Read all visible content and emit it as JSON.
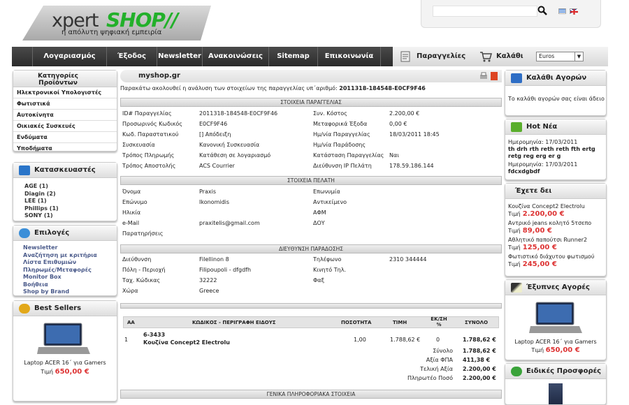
{
  "header": {
    "logo_xpert": "xpert",
    "logo_shop": "SHOP//",
    "tagline": "η απόλυτη ψηφιακή εμπειρία",
    "search_placeholder": ""
  },
  "nav": {
    "items": [
      "Λογαριασμός",
      "Έξοδος",
      "Newsletter",
      "Ανακοινώσεις",
      "Sitemap",
      "Επικοινωνία"
    ],
    "orders": "Παραγγελίες",
    "cart": "Καλάθι",
    "currency": "Euros"
  },
  "left": {
    "categories_title": "Κατηγορίες Προϊόντων",
    "categories": [
      "Ηλεκτρονικοί Υπολογιστές",
      "Φωτιστικά",
      "Αυτοκίνητα",
      "Οικιακές Συσκευές",
      "Ενδύματα",
      "Υποδήματα"
    ],
    "manufacturers_title": "Κατασκευαστές",
    "manufacturers": [
      "AGE (1)",
      "Diagin (2)",
      "LEE (1)",
      "Phillips (1)",
      "SONY (1)"
    ],
    "options_title": "Επιλογές",
    "options": [
      "Newsletter",
      "Αναζήτηση με κριτήρια",
      "Λίστα Επιθυμιών",
      "Πληρωμές/Μεταφορές",
      "Monitor Box",
      "Βοήθεια",
      "Shop by Brand"
    ],
    "bestsellers_title": "Best Sellers",
    "bestseller_name": "Laptop ACER 16΄ για Gamers",
    "bestseller_price_label": "Τιμή",
    "bestseller_price": "650,00 €"
  },
  "right": {
    "cart_title": "Καλάθι Αγορών",
    "cart_empty": "Το καλάθι αγορών σας είναι άδειο",
    "news_title": "Hot Νέα",
    "news": [
      {
        "date": "Ημερομηνία: 17/03/2011",
        "text": "th drh rth reth reth fth ertg retg reg erg er g"
      },
      {
        "date": "Ημερομηνία: 17/03/2011",
        "text": "fdcxdgbdf"
      }
    ],
    "seen_title": "Έχετε δει",
    "seen": [
      {
        "name": "Κουζίνα Concept2 Electrolu",
        "price": "2.200,00 €"
      },
      {
        "name": "Αντρικό jeans κολητό 5τσεπο",
        "price": "89,00 €"
      },
      {
        "name": "Αθλητικό παπούτσι Runner2",
        "price": "125,00 €"
      },
      {
        "name": "Φωτιστικό διάχυτου φωτισμού",
        "price": "245,00 €"
      }
    ],
    "price_label": "Τιμή",
    "smart_title": "Έξυπνες Αγορές",
    "smart_name": "Laptop ACER 16΄ για Gamers",
    "smart_price": "650,00 €",
    "offers_title": "Ειδικές Προσφορές"
  },
  "main": {
    "title": "myshop.gr",
    "intro": "Παρακάτω ακολουθεί η ανάλυση των στοιχείων της παραγγελίας υπ΄αριθμό:",
    "order_no": "2011318-184548-E0CF9F46",
    "order_section": "ΣΤΟΙΧΕΙΑ ΠΑΡΑΓΓΕΛΙΑΣ",
    "order_left": [
      [
        "ID# Παραγγελίας",
        "2011318-184548-E0CF9F46"
      ],
      [
        "Προσωρινός Κωδικός",
        "E0CF9F46"
      ],
      [
        "Κωδ. Παραστατικού",
        "[] Απόδειξη"
      ],
      [
        "Συσκευασία",
        "Κανονική Συσκευασία"
      ],
      [
        "Τρόπος Πληρωμής",
        "Κατάθεση σε λογαριασμό"
      ],
      [
        "Τρόπος Αποστολής",
        "ACS Courrier"
      ]
    ],
    "order_right": [
      [
        "Συν. Κόστος",
        "2.200,00 €"
      ],
      [
        "Μεταφορικά Έξοδα",
        "0,00 €"
      ],
      [
        "Ημ/νία Παραγγελίας",
        "18/03/2011 18:45"
      ],
      [
        "Ημ/νία Παράδοσης",
        ""
      ],
      [
        "Κατάσταση Παραγγελίας",
        "Ναι"
      ],
      [
        "Διεύθυνση IP Πελάτη",
        "178.59.186.144"
      ]
    ],
    "customer_section": "ΣΤΟΙΧΕΙΑ ΠΕΛΑΤΗ",
    "customer_left": [
      [
        "Όνομα",
        "Praxis"
      ],
      [
        "Επώνυμο",
        "Ikonomidis"
      ],
      [
        "Ηλικία",
        ""
      ],
      [
        "e-Mail",
        "praxitelis@gmail.com"
      ],
      [
        "Παρατηρήσεις",
        ""
      ]
    ],
    "customer_right": [
      [
        "Επωνυμία",
        ""
      ],
      [
        "Αντικείμενο",
        ""
      ],
      [
        "ΑΦΜ",
        ""
      ],
      [
        "ΔΟΥ",
        ""
      ]
    ],
    "delivery_section": "ΔΙΕΥΘΥΝΣΗ ΠΑΡΑΔΟΣΗΣ",
    "delivery_left": [
      [
        "Διεύθυνση",
        "Filellinon 8"
      ],
      [
        "Πόλη - Περιοχή",
        "Filipoupoli - dfgdfh"
      ],
      [
        "Ταχ. Κώδικας",
        "32222"
      ],
      [
        "Χώρα",
        "Greece"
      ]
    ],
    "delivery_right": [
      [
        "Τηλέφωνο",
        "2310 344444"
      ],
      [
        "Κινητό Τηλ.",
        ""
      ],
      [
        "Φαξ",
        ""
      ]
    ],
    "table_headers": [
      "AA",
      "ΚΩΔΙΚΟΣ - ΠΕΡΙΓΡΑΦΗ ΕΙΔΟΥΣ",
      "ΠΟΣΟΤΗΤΑ",
      "ΤΙΜΗ",
      "ΕΚ/ΣΗ %",
      "ΣΥΝΟΛΟ"
    ],
    "row": {
      "aa": "1",
      "code": "6-3433",
      "name": "Κουζίνα Concept2 Electrolu",
      "qty": "1,00",
      "price": "1.788,62 €",
      "disc": "0",
      "total": "1.788,62 €"
    },
    "totals": [
      [
        "Σύνολο",
        "1.788,62 €"
      ],
      [
        "Αξία ΦΠΑ",
        "411,38 €"
      ],
      [
        "Τελική Αξία",
        "2.200,00 €"
      ],
      [
        "Πληρωτέο Ποσό",
        "2.200,00 €"
      ]
    ],
    "general_section": "ΓΕΝΙΚΑ ΠΛΗΡΟΦΟΡΙΑΚΑ ΣΤΟΙΧΕΙΑ"
  }
}
